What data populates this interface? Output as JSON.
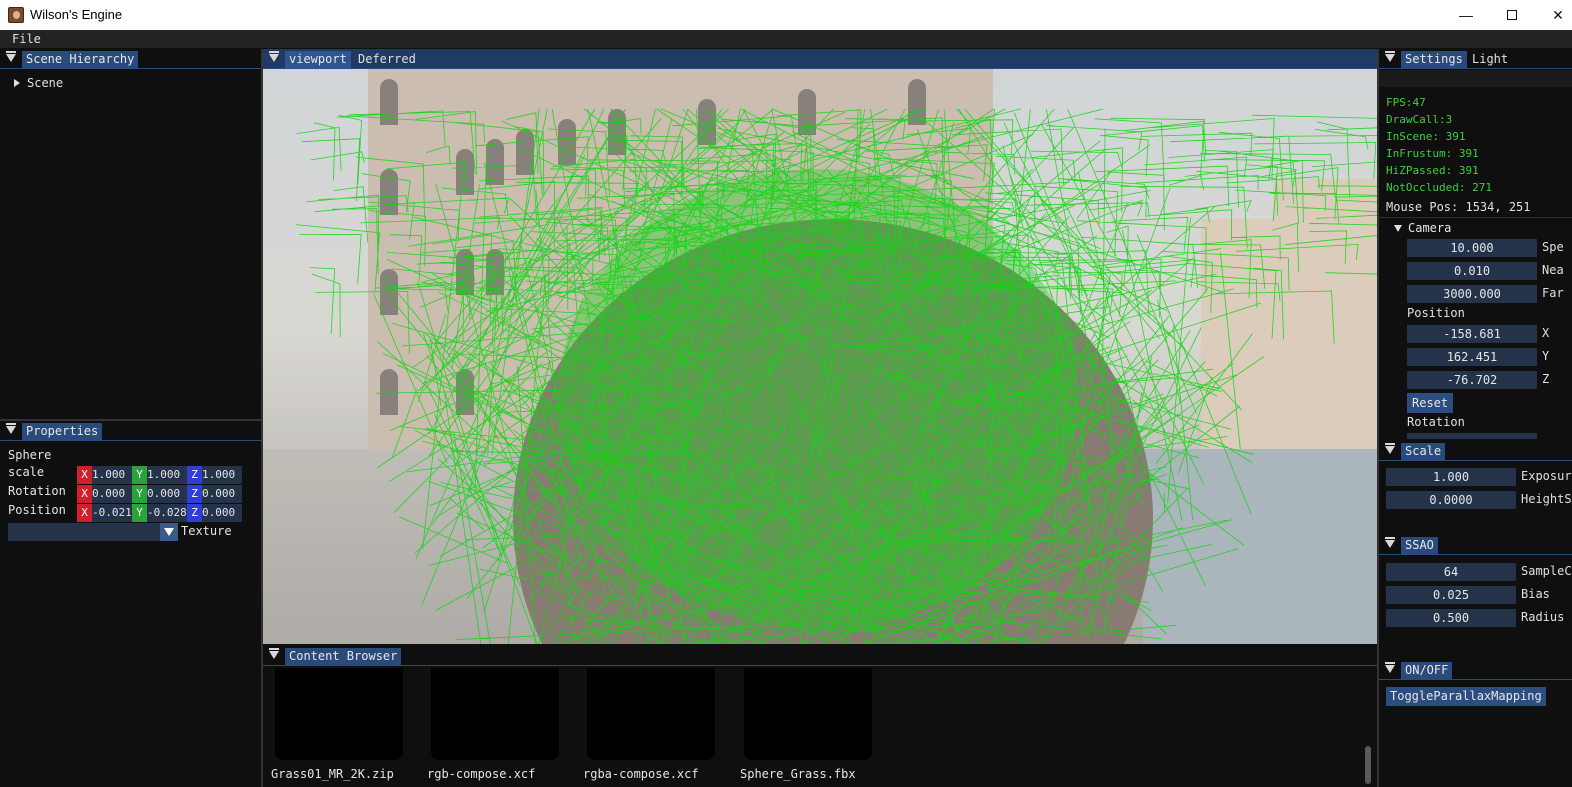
{
  "window": {
    "title": "Wilson's Engine",
    "min": "—",
    "close": "✕"
  },
  "menu": {
    "file": "File"
  },
  "hierarchy": {
    "tab": "Scene Hierarchy",
    "root": "Scene"
  },
  "properties": {
    "tab": "Properties",
    "object": "Sphere",
    "rows": [
      {
        "label": "scale",
        "x": "1.000",
        "y": "1.000",
        "z": "1.000"
      },
      {
        "label": "Rotation",
        "x": "0.000",
        "y": "0.000",
        "z": "0.000"
      },
      {
        "label": "Position",
        "x": "-0.021",
        "y": "-0.028",
        "z": "0.000"
      }
    ],
    "texture": "Texture"
  },
  "viewport": {
    "tabs": [
      "viewport",
      "Deferred"
    ]
  },
  "settings": {
    "tabs": [
      "Settings",
      "Light"
    ],
    "stats": [
      "FPS:47",
      "DrawCall:3",
      "InScene: 391",
      "InFrustum: 391",
      "HiZPassed: 391",
      "NotOccluded: 271"
    ],
    "mouse": "Mouse Pos: 1534, 251",
    "camera": {
      "header": "Camera",
      "speed": "10.000",
      "speed_label": "Spe",
      "near": "0.010",
      "near_label": "Nea",
      "far": "3000.000",
      "far_label": "Far",
      "position_label": "Position",
      "px": "-158.681",
      "py": "162.451",
      "pz": "-76.702",
      "reset": "Reset",
      "rotation_label": "Rotation"
    }
  },
  "scale_panel": {
    "tab": "Scale",
    "exposure": "1.000",
    "exposure_label": "Exposur",
    "height": "0.0000",
    "height_label": "HeightS"
  },
  "ssao": {
    "tab": "SSAO",
    "samples": "64",
    "samples_label": "SampleC",
    "bias": "0.025",
    "bias_label": "Bias",
    "radius": "0.500",
    "radius_label": "Radius"
  },
  "onoff": {
    "tab": "ON/OFF",
    "toggle": "ToggleParallaxMapping"
  },
  "content": {
    "tab": "Content Browser",
    "files": [
      "Grass01_MR_2K.zip",
      "rgb-compose.xcf",
      "rgba-compose.xcf",
      "Sphere_Grass.fbx"
    ]
  },
  "colors": {
    "accent": "#294a7a",
    "stats_green": "#3ecf3e",
    "wire_green": "#14d414"
  }
}
